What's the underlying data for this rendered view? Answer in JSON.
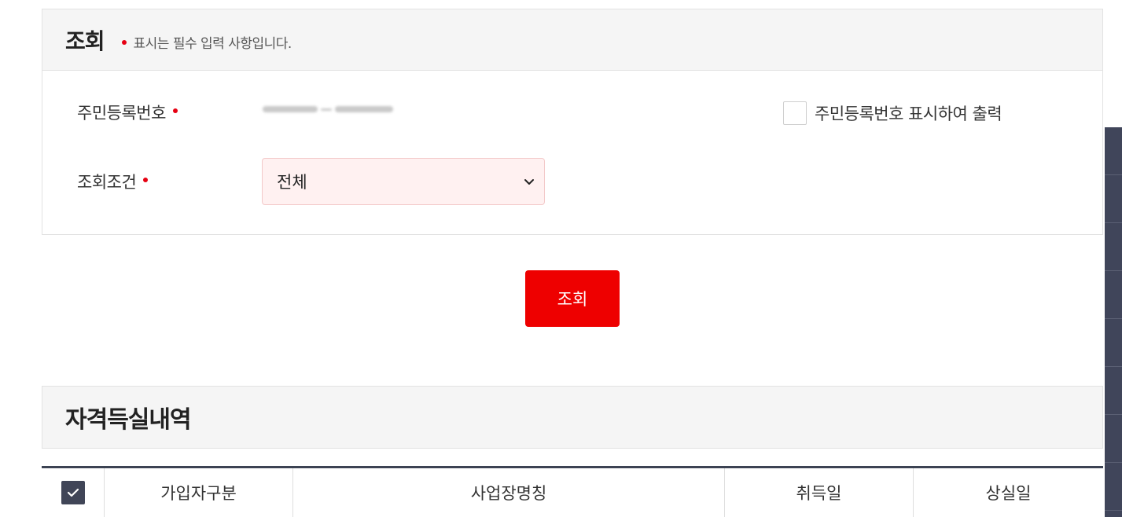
{
  "search_panel": {
    "title": "조회",
    "required_note": "표시는 필수 입력 사항입니다.",
    "rrn_label": "주민등록번호",
    "condition_label": "조회조건",
    "condition_value": "전체",
    "print_option_label": "주민등록번호 표시하여 출력",
    "print_option_checked": false
  },
  "actions": {
    "search_label": "조회"
  },
  "results": {
    "title": "자격득실내역",
    "columns": [
      "가입자구분",
      "사업장명칭",
      "취득일",
      "상실일"
    ],
    "select_all_checked": true
  },
  "colors": {
    "accent_red": "#ee0000",
    "required_dot": "#e60012",
    "header_bg": "#f5f5f5",
    "table_border": "#3c4353",
    "select_bg": "#fff1f1"
  }
}
